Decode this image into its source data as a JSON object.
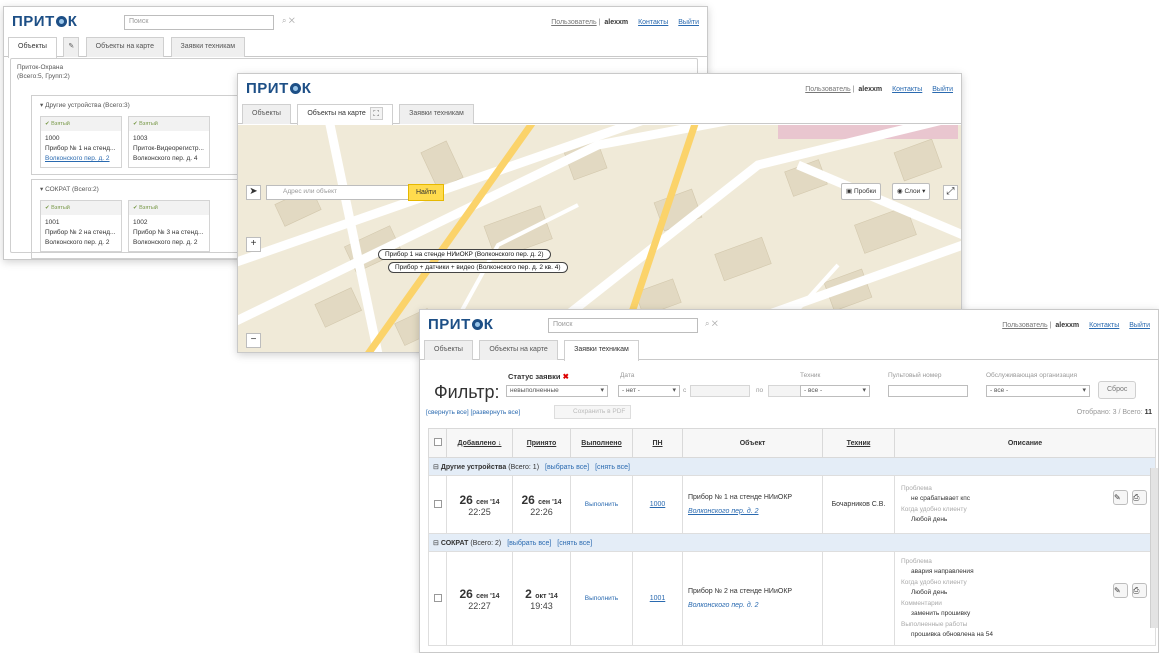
{
  "logo": "ПРИТОК",
  "common": {
    "search_placeholder": "Поиск",
    "user_prefix": "Пользователь",
    "username": "alexxm",
    "contacts": "Контакты",
    "logout": "Выйти"
  },
  "tabs": [
    "Объекты",
    "Объекты на карте",
    "Заявки техникам"
  ],
  "window1": {
    "root_title": "Приток-Охрана",
    "root_counts": "(Всего:5, Групп:2)",
    "group1": {
      "title": "Другие устройства (Всего:3)",
      "cards": [
        {
          "status": "Взятый",
          "id": "1000",
          "name": "Прибор № 1 на стенд...",
          "addr": "Волконского пер. д. 2"
        },
        {
          "status": "Взятый",
          "id": "1003",
          "name": "Приток-Видеорегистр...",
          "addr": "Волконского пер. д. 4"
        }
      ]
    },
    "group2": {
      "title": "СОКРАТ (Всего:2)",
      "cards": [
        {
          "status": "Взятый",
          "id": "1001",
          "name": "Прибор № 2 на стенд...",
          "addr": "Волконского пер. д. 2"
        },
        {
          "status": "Взятый",
          "id": "1002",
          "name": "Прибор № 3 на стенд...",
          "addr": "Волконского пер. д. 2"
        }
      ]
    }
  },
  "window2": {
    "address_placeholder": "Адрес или объект",
    "find_button": "Найти",
    "traffic_button": "Пробки",
    "layers_button": "Слои",
    "labels": [
      "Прибор 1 на стенде НИиОКР (Волконского пер. д. 2)",
      "Прибор + датчики + видео (Волконского пер. д. 2 кв. 4)"
    ]
  },
  "window3": {
    "filter_title": "Фильтр:",
    "status_label": "Статус заявки",
    "status_value": "невыполненные",
    "date_label": "Дата",
    "date_value": "- нет -",
    "date_from": "с",
    "date_to": "по",
    "tech_label": "Техник",
    "tech_value": "- все -",
    "panel_label": "Пультовый номер",
    "org_label": "Обслуживающая организация",
    "org_value": "- все -",
    "reset_button": "Сброс",
    "collapse_all": "[свернуть все]",
    "expand_all": "[развернуть все]",
    "save_pdf": "Сохранить в PDF",
    "counter_prefix": "Отобрано: 3 / Всего:",
    "counter_total": "11",
    "columns": {
      "added": "Добавлено",
      "accepted": "Принято",
      "done": "Выполнено",
      "pn": "ПН",
      "object": "Объект",
      "tech": "Техник",
      "desc": "Описание"
    },
    "group1": {
      "name": "Другие устройства",
      "count": "(Всего: 1)",
      "select_all": "[выбрать все]",
      "clear_all": "[снять все]"
    },
    "group2": {
      "name": "СОКРАТ",
      "count": "(Всего: 2)",
      "select_all": "[выбрать все]",
      "clear_all": "[снять все]"
    },
    "rows": [
      {
        "added_day": "26",
        "added_mon": "сен '14",
        "added_time": "22:25",
        "acc_day": "26",
        "acc_mon": "сен '14",
        "acc_time": "22:26",
        "done": "Выполнить",
        "pn": "1000",
        "object": "Прибор № 1 на стенде НИиОКР",
        "addr": "Волконского пер. д. 2",
        "tech": "Бочарников С.В.",
        "d1k": "Проблема",
        "d1v": "не срабатывает кпс",
        "d2k": "Когда удобно клиенту",
        "d2v": "Любой день"
      },
      {
        "added_day": "26",
        "added_mon": "сен '14",
        "added_time": "22:27",
        "acc_day": "2",
        "acc_mon": "окт '14",
        "acc_time": "19:43",
        "done": "Выполнить",
        "pn": "1001",
        "object": "Прибор № 2 на стенде НИиОКР",
        "addr": "Волконского пер. д. 2",
        "tech": "",
        "d1k": "Проблема",
        "d1v": "авария направления",
        "d2k": "Когда удобно клиенту",
        "d2v": "Любой день",
        "d3k": "Комментарии",
        "d3v": "заменить прошивку",
        "d4k": "Выполненные работы",
        "d4v": "прошивка обновлена на 54"
      }
    ]
  },
  "colors": {
    "brand": "#1d4f86",
    "link": "#2a6ab0",
    "group_row": "#e4edf7",
    "find_button": "#ffdb4d",
    "map_bg": "#f0ead8"
  }
}
